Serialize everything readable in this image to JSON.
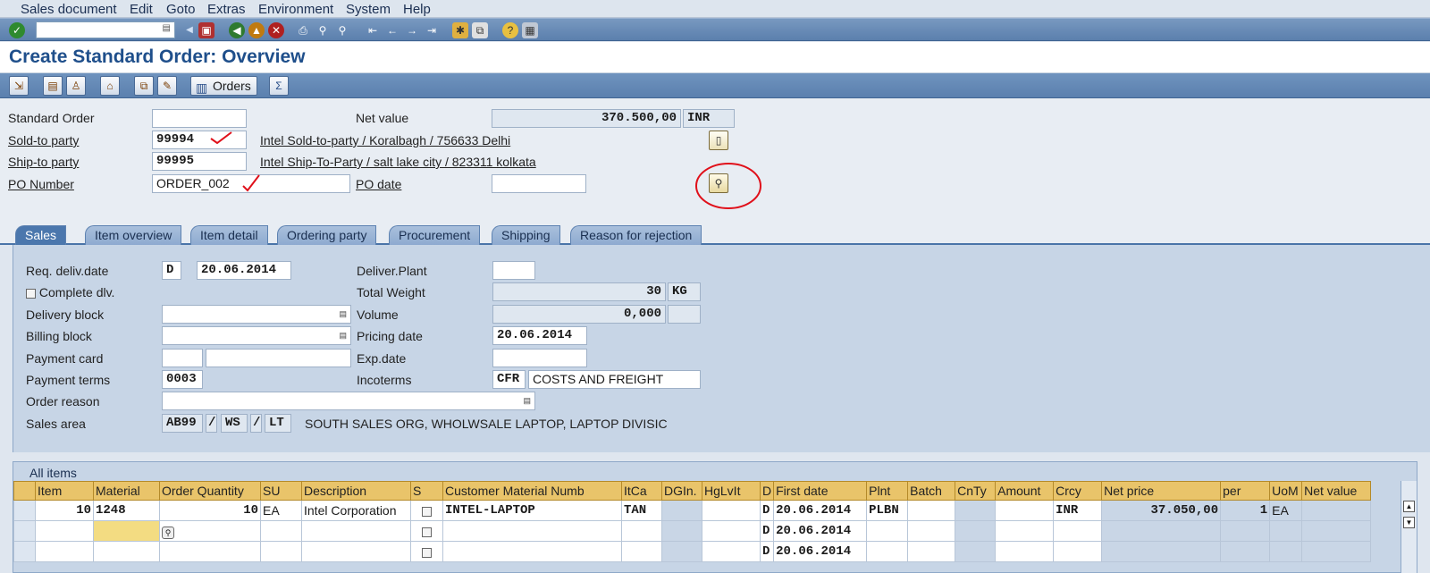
{
  "menu": [
    "Sales document",
    "Edit",
    "Goto",
    "Extras",
    "Environment",
    "System",
    "Help"
  ],
  "toolbar": {
    "command_value": ""
  },
  "title": "Create Standard Order: Overview",
  "app_toolbar": {
    "orders_label": "Orders"
  },
  "header": {
    "standard_order_label": "Standard Order",
    "standard_order_value": "",
    "sold_to_label": "Sold-to party",
    "sold_to_value": "99994",
    "sold_to_desc": "Intel Sold-to-party / Koralbagh / 756633 Delhi",
    "ship_to_label": "Ship-to party",
    "ship_to_value": "99995",
    "ship_to_desc": "Intel Ship-To-Party / salt lake city / 823311 kolkata",
    "po_number_label": "PO Number",
    "po_number_value": "ORDER_002",
    "net_value_label": "Net value",
    "net_value": "370.500,00",
    "currency": "INR",
    "po_date_label": "PO date",
    "po_date_value": ""
  },
  "tabs": [
    "Sales",
    "Item overview",
    "Item detail",
    "Ordering party",
    "Procurement",
    "Shipping",
    "Reason for rejection"
  ],
  "sales_tab": {
    "req_deliv_date_label": "Req. deliv.date",
    "req_deliv_date_type": "D",
    "req_deliv_date": "20.06.2014",
    "complete_dlv_label": "Complete dlv.",
    "delivery_block_label": "Delivery block",
    "billing_block_label": "Billing block",
    "payment_card_label": "Payment card",
    "payment_terms_label": "Payment terms",
    "payment_terms_value": "0003",
    "order_reason_label": "Order reason",
    "sales_area_label": "Sales area",
    "sales_org": "AB99",
    "dist_channel": "WS",
    "division": "LT",
    "sales_area_sep": "/",
    "sales_area_desc": "SOUTH SALES ORG, WHOLWSALE LAPTOP, LAPTOP DIVISIC",
    "deliver_plant_label": "Deliver.Plant",
    "total_weight_label": "Total Weight",
    "total_weight": "30",
    "weight_unit": "KG",
    "volume_label": "Volume",
    "volume": "0,000",
    "pricing_date_label": "Pricing date",
    "pricing_date": "20.06.2014",
    "exp_date_label": "Exp.date",
    "incoterms_label": "Incoterms",
    "incoterms_code": "CFR",
    "incoterms_desc": "COSTS AND FREIGHT"
  },
  "items": {
    "title": "All items",
    "columns": [
      "Item",
      "Material",
      "Order Quantity",
      "SU",
      "Description",
      "S",
      "Customer Material Numb",
      "ItCa",
      "DGIn.",
      "HgLvIt",
      "D",
      "First date",
      "Plnt",
      "Batch",
      "CnTy",
      "Amount",
      "Crcy",
      "Net price",
      "per",
      "UoM",
      "Net value"
    ],
    "rows": [
      {
        "item": "10",
        "material": "1248",
        "qty": "10",
        "su": "EA",
        "desc": "Intel Corporation",
        "cust_mat": "INTEL-LAPTOP",
        "itca": "TAN",
        "d": "D",
        "first_date": "20.06.2014",
        "plnt": "PLBN",
        "crcy": "INR",
        "net_price": "37.050,00",
        "per": "1",
        "uom": "EA"
      },
      {
        "item": "",
        "material": "",
        "qty": "",
        "su": "",
        "desc": "",
        "cust_mat": "",
        "itca": "",
        "d": "D",
        "first_date": "20.06.2014",
        "plnt": "",
        "crcy": "",
        "net_price": "",
        "per": "",
        "uom": ""
      },
      {
        "item": "",
        "material": "",
        "qty": "",
        "su": "",
        "desc": "",
        "cust_mat": "",
        "itca": "",
        "d": "D",
        "first_date": "20.06.2014",
        "plnt": "",
        "crcy": "",
        "net_price": "",
        "per": "",
        "uom": ""
      }
    ]
  }
}
